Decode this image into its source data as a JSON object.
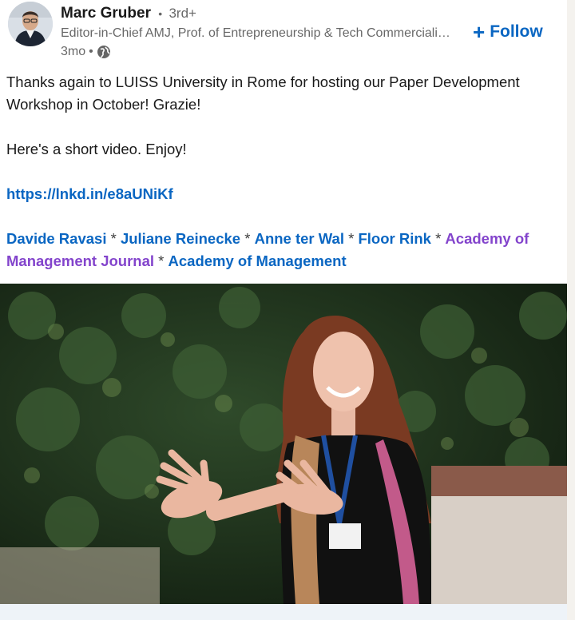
{
  "header": {
    "author_name": "Marc Gruber",
    "degree": "3rd+",
    "headline": "Editor-in-Chief AMJ, Prof. of Entrepreneurship & Tech Commercialization",
    "time_ago": "3mo",
    "visibility_icon": "globe-icon",
    "follow_label": "Follow"
  },
  "post": {
    "line1": "Thanks again to LUISS University in Rome for hosting our Paper Development",
    "line2": "Workshop in October! Grazie!",
    "line3": "Here's a short video. Enjoy!",
    "url": "https://lnkd.in/e8aUNiKf",
    "sep": " * ",
    "mentions": [
      "Davide Ravasi",
      "Juliane Reinecke",
      "Anne ter Wal",
      "Floor Rink",
      "Academy of Management Journal",
      "Academy of Management"
    ]
  },
  "colors": {
    "link": "#0a66c2",
    "visited_link": "#8344cc",
    "secondary_text": "#666666"
  }
}
